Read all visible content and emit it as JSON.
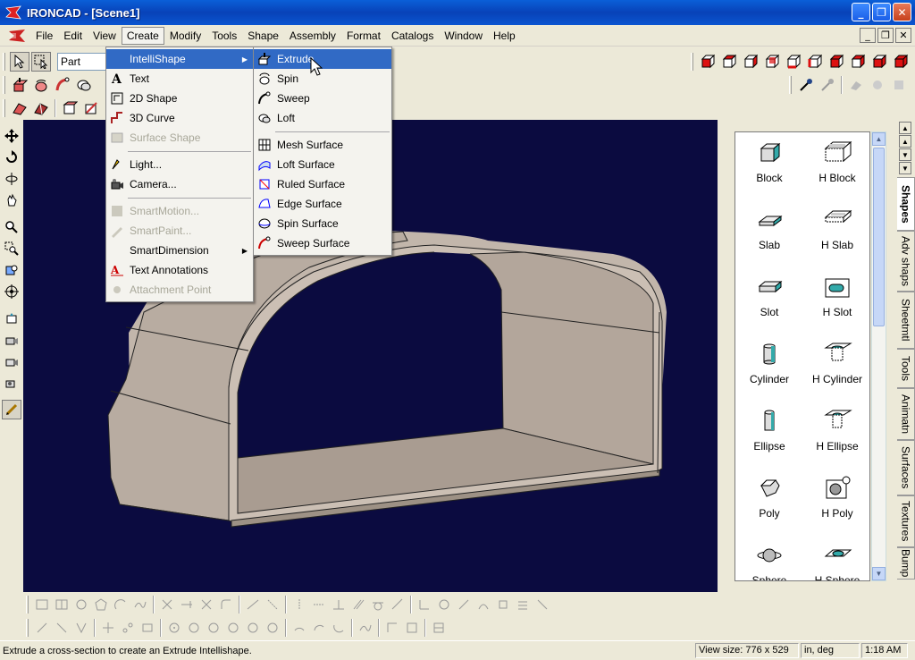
{
  "window": {
    "title": "IRONCAD - [Scene1]"
  },
  "colors": {
    "titlebar": "#0a52d0",
    "viewport_bg": "#0b0b40",
    "highlight": "#316ac5",
    "model_face": "#bfb3a8"
  },
  "menubar": [
    "File",
    "Edit",
    "View",
    "Create",
    "Modify",
    "Tools",
    "Shape",
    "Assembly",
    "Format",
    "Catalogs",
    "Window",
    "Help"
  ],
  "toolbar": {
    "part_combo": "Part"
  },
  "create_menu": [
    {
      "label": "IntelliShape",
      "icon": "none",
      "submenu": true,
      "state": "highlighted"
    },
    {
      "label": "Text",
      "icon": "text-icon"
    },
    {
      "label": "2D Shape",
      "icon": "2d-shape-icon"
    },
    {
      "label": "3D Curve",
      "icon": "3d-curve-icon"
    },
    {
      "label": "Surface Shape",
      "icon": "surface-shape-icon",
      "state": "disabled"
    },
    {
      "label": "Light...",
      "icon": "light-icon"
    },
    {
      "label": "Camera...",
      "icon": "camera-icon"
    },
    {
      "label": "SmartMotion...",
      "icon": "smartmotion-icon",
      "state": "disabled"
    },
    {
      "label": "SmartPaint...",
      "icon": "smartpaint-icon",
      "state": "disabled"
    },
    {
      "label": "SmartDimension",
      "icon": "none",
      "submenu": true
    },
    {
      "label": "Text Annotations",
      "icon": "text-annotation-icon"
    },
    {
      "label": "Attachment Point",
      "icon": "attachment-point-icon",
      "state": "disabled"
    }
  ],
  "intellishape_menu": [
    {
      "label": "Extrude",
      "icon": "extrude-icon",
      "state": "highlighted"
    },
    {
      "label": "Spin",
      "icon": "spin-icon"
    },
    {
      "label": "Sweep",
      "icon": "sweep-icon"
    },
    {
      "label": "Loft",
      "icon": "loft-icon"
    },
    {
      "label": "Mesh Surface",
      "icon": "mesh-surface-icon"
    },
    {
      "label": "Loft Surface",
      "icon": "loft-surface-icon"
    },
    {
      "label": "Ruled Surface",
      "icon": "ruled-surface-icon"
    },
    {
      "label": "Edge Surface",
      "icon": "edge-surface-icon"
    },
    {
      "label": "Spin Surface",
      "icon": "spin-surface-icon"
    },
    {
      "label": "Sweep Surface",
      "icon": "sweep-surface-icon"
    }
  ],
  "catalog": {
    "items": [
      "Block",
      "H Block",
      "Slab",
      "H Slab",
      "Slot",
      "H Slot",
      "Cylinder",
      "H Cylinder",
      "Ellipse",
      "H Ellipse",
      "Poly",
      "H Poly",
      "Sphere",
      "H Sphere"
    ],
    "tabs": [
      "Shapes",
      "Adv shaps",
      "Sheetmtl",
      "Tools",
      "Animatn",
      "Surfaces",
      "Textures",
      "Bump"
    ],
    "active_tab": "Shapes"
  },
  "status": {
    "message": "Extrude a cross-section to create an Extrude Intellishape.",
    "view_size": "View size:   776 x  529",
    "units": "in, deg",
    "time": "1:18 AM"
  }
}
